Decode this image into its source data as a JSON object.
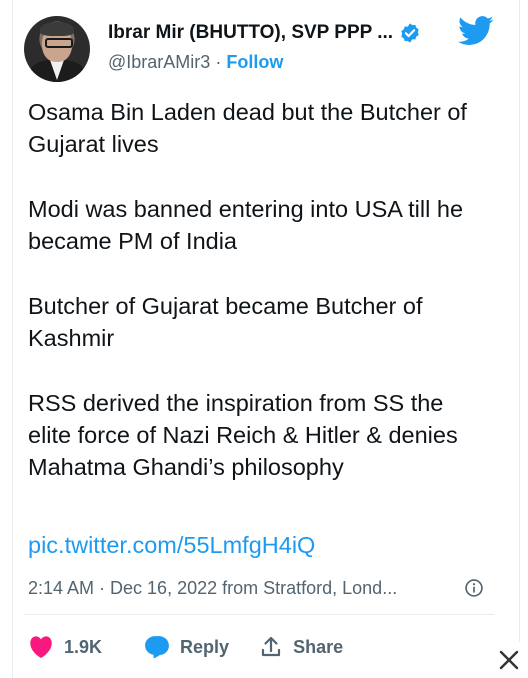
{
  "user": {
    "display_name": "Ibrar Mir (BHUTTO), SVP PPP ...",
    "handle": "@IbrarAMir3",
    "separator": "·",
    "follow_label": "Follow"
  },
  "tweet": {
    "paragraphs": [
      "Osama Bin Laden dead but the Butcher of Gujarat lives",
      "Modi was banned entering into USA till he became PM of India",
      "Butcher of Gujarat became Butcher of Kashmir",
      "RSS derived the inspiration from SS the elite force of Nazi Reich & Hitler & denies Mahatma Ghandi’s philosophy"
    ],
    "link": "pic.twitter.com/55LmfgH4iQ",
    "meta": "2:14 AM · Dec 16, 2022 from Stratford, Lond..."
  },
  "actions": {
    "like_count": "1.9K",
    "reply_label": "Reply",
    "share_label": "Share"
  },
  "colors": {
    "accent": "#1d9bf0",
    "like": "#f91880",
    "text": "#0f1419",
    "muted": "#536471"
  },
  "icons": [
    "twitter-logo-icon",
    "verified-badge-icon",
    "info-icon",
    "heart-icon",
    "reply-bubble-icon",
    "share-icon",
    "close-icon"
  ]
}
